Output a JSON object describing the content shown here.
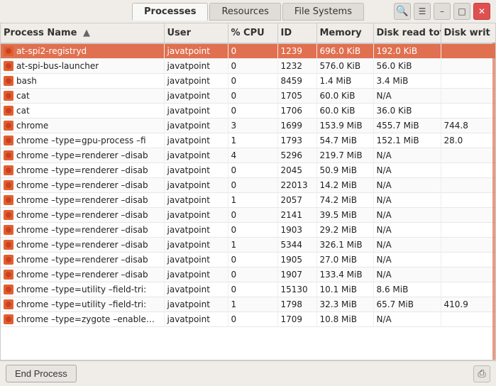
{
  "titlebar": {
    "tabs": [
      {
        "label": "Processes",
        "active": true
      },
      {
        "label": "Resources",
        "active": false
      },
      {
        "label": "File Systems",
        "active": false
      }
    ],
    "search_icon": "🔍",
    "menu_icon": "☰",
    "min_icon": "–",
    "max_icon": "□",
    "close_icon": "✕"
  },
  "table": {
    "columns": [
      {
        "key": "name",
        "label": "Process Name",
        "sortable": true,
        "sort_dir": "asc"
      },
      {
        "key": "user",
        "label": "User",
        "sortable": false
      },
      {
        "key": "cpu",
        "label": "% CPU",
        "sortable": false
      },
      {
        "key": "id",
        "label": "ID",
        "sortable": false
      },
      {
        "key": "memory",
        "label": "Memory",
        "sortable": false
      },
      {
        "key": "disk_read",
        "label": "Disk read tota",
        "sortable": false
      },
      {
        "key": "disk_write",
        "label": "Disk writ",
        "sortable": false
      }
    ],
    "rows": [
      {
        "name": "at-spi2-registryd",
        "user": "javatpoint",
        "cpu": "0",
        "id": "1239",
        "memory": "696.0 KiB",
        "disk_read": "192.0 KiB",
        "disk_write": "",
        "selected": true
      },
      {
        "name": "at-spi-bus-launcher",
        "user": "javatpoint",
        "cpu": "0",
        "id": "1232",
        "memory": "576.0 KiB",
        "disk_read": "56.0 KiB",
        "disk_write": "",
        "selected": false
      },
      {
        "name": "bash",
        "user": "javatpoint",
        "cpu": "0",
        "id": "8459",
        "memory": "1.4 MiB",
        "disk_read": "3.4 MiB",
        "disk_write": "",
        "selected": false
      },
      {
        "name": "cat",
        "user": "javatpoint",
        "cpu": "0",
        "id": "1705",
        "memory": "60.0 KiB",
        "disk_read": "N/A",
        "disk_write": "",
        "selected": false
      },
      {
        "name": "cat",
        "user": "javatpoint",
        "cpu": "0",
        "id": "1706",
        "memory": "60.0 KiB",
        "disk_read": "36.0 KiB",
        "disk_write": "",
        "selected": false
      },
      {
        "name": "chrome",
        "user": "javatpoint",
        "cpu": "3",
        "id": "1699",
        "memory": "153.9 MiB",
        "disk_read": "455.7 MiB",
        "disk_write": "744.8",
        "selected": false
      },
      {
        "name": "chrome –type=gpu-process –fi",
        "user": "javatpoint",
        "cpu": "1",
        "id": "1793",
        "memory": "54.7 MiB",
        "disk_read": "152.1 MiB",
        "disk_write": "28.0",
        "selected": false
      },
      {
        "name": "chrome –type=renderer –disab",
        "user": "javatpoint",
        "cpu": "4",
        "id": "5296",
        "memory": "219.7 MiB",
        "disk_read": "N/A",
        "disk_write": "",
        "selected": false
      },
      {
        "name": "chrome –type=renderer –disab",
        "user": "javatpoint",
        "cpu": "0",
        "id": "2045",
        "memory": "50.9 MiB",
        "disk_read": "N/A",
        "disk_write": "",
        "selected": false
      },
      {
        "name": "chrome –type=renderer –disab",
        "user": "javatpoint",
        "cpu": "0",
        "id": "22013",
        "memory": "14.2 MiB",
        "disk_read": "N/A",
        "disk_write": "",
        "selected": false
      },
      {
        "name": "chrome –type=renderer –disab",
        "user": "javatpoint",
        "cpu": "1",
        "id": "2057",
        "memory": "74.2 MiB",
        "disk_read": "N/A",
        "disk_write": "",
        "selected": false
      },
      {
        "name": "chrome –type=renderer –disab",
        "user": "javatpoint",
        "cpu": "0",
        "id": "2141",
        "memory": "39.5 MiB",
        "disk_read": "N/A",
        "disk_write": "",
        "selected": false
      },
      {
        "name": "chrome –type=renderer –disab",
        "user": "javatpoint",
        "cpu": "0",
        "id": "1903",
        "memory": "29.2 MiB",
        "disk_read": "N/A",
        "disk_write": "",
        "selected": false
      },
      {
        "name": "chrome –type=renderer –disab",
        "user": "javatpoint",
        "cpu": "1",
        "id": "5344",
        "memory": "326.1 MiB",
        "disk_read": "N/A",
        "disk_write": "",
        "selected": false
      },
      {
        "name": "chrome –type=renderer –disab",
        "user": "javatpoint",
        "cpu": "0",
        "id": "1905",
        "memory": "27.0 MiB",
        "disk_read": "N/A",
        "disk_write": "",
        "selected": false
      },
      {
        "name": "chrome –type=renderer –disab",
        "user": "javatpoint",
        "cpu": "0",
        "id": "1907",
        "memory": "133.4 MiB",
        "disk_read": "N/A",
        "disk_write": "",
        "selected": false
      },
      {
        "name": "chrome –type=utility –field-tri:",
        "user": "javatpoint",
        "cpu": "0",
        "id": "15130",
        "memory": "10.1 MiB",
        "disk_read": "8.6 MiB",
        "disk_write": "",
        "selected": false
      },
      {
        "name": "chrome –type=utility –field-tri:",
        "user": "javatpoint",
        "cpu": "1",
        "id": "1798",
        "memory": "32.3 MiB",
        "disk_read": "65.7 MiB",
        "disk_write": "410.9",
        "selected": false
      },
      {
        "name": "chrome –type=zygote –enable-javatpoint",
        "user": "javatpoint",
        "cpu": "0",
        "id": "1709",
        "memory": "10.8 MiB",
        "disk_read": "N/A",
        "disk_write": "",
        "selected": false
      }
    ]
  },
  "footer": {
    "end_process_label": "End Process"
  }
}
